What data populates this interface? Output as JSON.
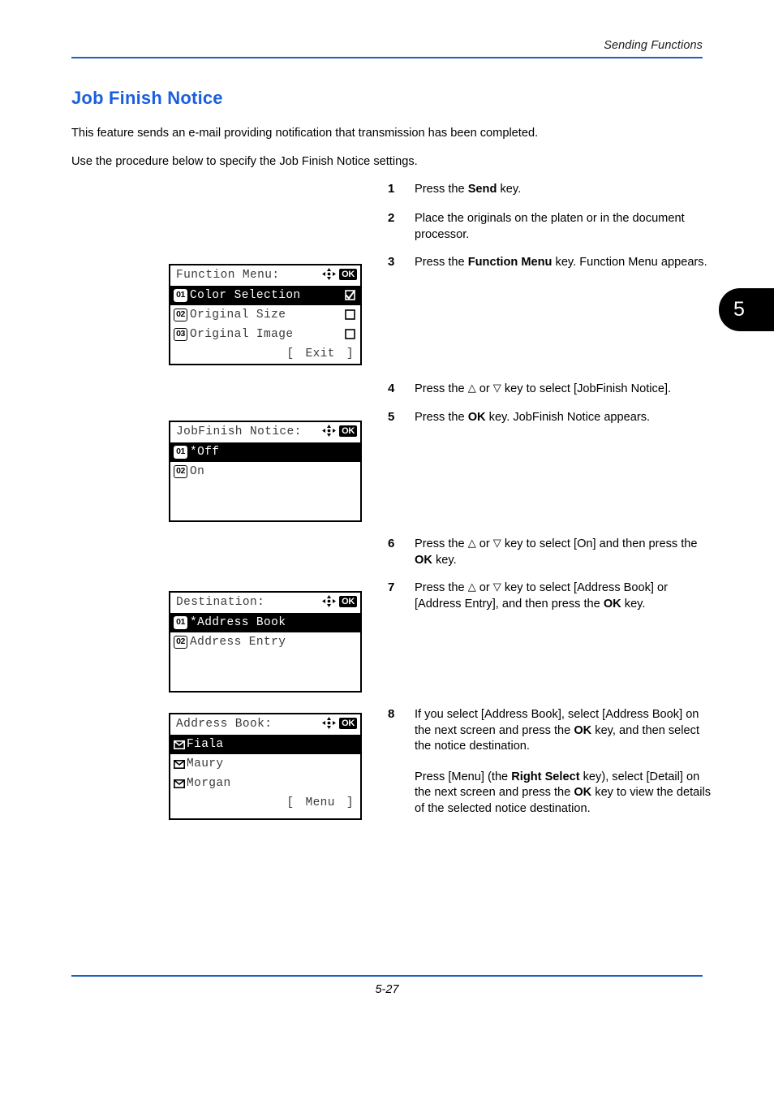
{
  "header": {
    "running_title": "Sending Functions"
  },
  "footer": {
    "page_number": "5-27"
  },
  "chapter_tab": {
    "number": "5"
  },
  "page_heading": "Job Finish Notice",
  "intro": {
    "paragraph_1": "This feature sends an e-mail providing notification that transmission has been completed.",
    "paragraph_2": "Use the procedure below to specify the Job Finish Notice settings."
  },
  "steps": [
    {
      "number": "1",
      "parts": [
        {
          "t": "Press the "
        },
        {
          "t": "Send",
          "b": true
        },
        {
          "t": " key."
        }
      ]
    },
    {
      "number": "2",
      "parts": [
        {
          "t": "Place the originals on the platen or in the document processor."
        }
      ]
    },
    {
      "number": "3",
      "parts": [
        {
          "t": "Press the "
        },
        {
          "t": "Function Menu",
          "b": true
        },
        {
          "t": " key. Function Menu appears."
        }
      ]
    },
    {
      "number": "4",
      "parts": [
        {
          "t": "Press the "
        },
        {
          "t": "△",
          "tri": true
        },
        {
          "t": " or "
        },
        {
          "t": "▽",
          "tri": true
        },
        {
          "t": " key to select [JobFinish Notice]."
        }
      ]
    },
    {
      "number": "5",
      "parts": [
        {
          "t": "Press the "
        },
        {
          "t": "OK",
          "b": true
        },
        {
          "t": " key. JobFinish Notice appears."
        }
      ]
    },
    {
      "number": "6",
      "parts": [
        {
          "t": "Press the "
        },
        {
          "t": "△",
          "tri": true
        },
        {
          "t": " or "
        },
        {
          "t": "▽",
          "tri": true
        },
        {
          "t": " key to select [On] and then press the "
        },
        {
          "t": "OK",
          "b": true
        },
        {
          "t": " key."
        }
      ]
    },
    {
      "number": "7",
      "parts": [
        {
          "t": "Press the "
        },
        {
          "t": "△",
          "tri": true
        },
        {
          "t": " or "
        },
        {
          "t": "▽",
          "tri": true
        },
        {
          "t": " key to select [Address Book] or [Address Entry], and then press the "
        },
        {
          "t": "OK",
          "b": true
        },
        {
          "t": " key."
        }
      ]
    },
    {
      "number": "8",
      "parts": [
        {
          "t": "If you select [Address Book], select [Address Book] on the next screen and press the "
        },
        {
          "t": "OK",
          "b": true
        },
        {
          "t": " key, and then select the notice destination."
        },
        {
          "br": true
        },
        {
          "t": "Press [Menu] (the "
        },
        {
          "t": "Right Select",
          "b": true
        },
        {
          "t": " key), select [Detail] on the next screen and press the "
        },
        {
          "t": "OK",
          "b": true
        },
        {
          "t": " key to view the details of the selected notice destination."
        }
      ]
    }
  ],
  "lcd_panels": [
    {
      "name": "function-menu",
      "title": "Function Menu:",
      "nav_icon": "dpad-icon",
      "ok_badge": "OK",
      "items": [
        {
          "badge": "01",
          "label": "Color Selection",
          "selected": true,
          "check": "checked"
        },
        {
          "badge": "02",
          "label": "Original Size",
          "selected": false,
          "check": "unchecked"
        },
        {
          "badge": "03",
          "label": "Original Image",
          "selected": false,
          "check": "unchecked"
        }
      ],
      "softkey": {
        "open": "[",
        "label": "Exit",
        "close": "]"
      },
      "blank_rows": 0
    },
    {
      "name": "jobfinish-notice",
      "title": "JobFinish Notice:",
      "nav_icon": "dpad-icon",
      "ok_badge": "OK",
      "items": [
        {
          "badge": "01",
          "label": "*Off",
          "selected": true,
          "check": "none"
        },
        {
          "badge": "02",
          "label": "On",
          "selected": false,
          "check": "none"
        }
      ],
      "softkey": null,
      "blank_rows": 2
    },
    {
      "name": "destination",
      "title": "Destination:",
      "nav_icon": "dpad-icon",
      "ok_badge": "OK",
      "items": [
        {
          "badge": "01",
          "label": "*Address Book",
          "selected": true,
          "check": "none"
        },
        {
          "badge": "02",
          "label": "Address Entry",
          "selected": false,
          "check": "none"
        }
      ],
      "softkey": null,
      "blank_rows": 2
    },
    {
      "name": "address-book",
      "title": "Address Book:",
      "nav_icon": "dpad-icon",
      "ok_badge": "OK",
      "items": [
        {
          "icon": "envelope-icon",
          "label": "Fiala",
          "selected": true
        },
        {
          "icon": "envelope-icon",
          "label": "Maury",
          "selected": false
        },
        {
          "icon": "envelope-icon",
          "label": "Morgan",
          "selected": false
        }
      ],
      "softkey": {
        "open": "[",
        "label": "Menu",
        "close": "]"
      },
      "blank_rows": 0
    }
  ],
  "colors": {
    "heading_blue": "#1a5fe0",
    "rule_blue": "#1f5fbf",
    "lcd_text": "#3a3a3a",
    "selection_bg": "#000000"
  }
}
